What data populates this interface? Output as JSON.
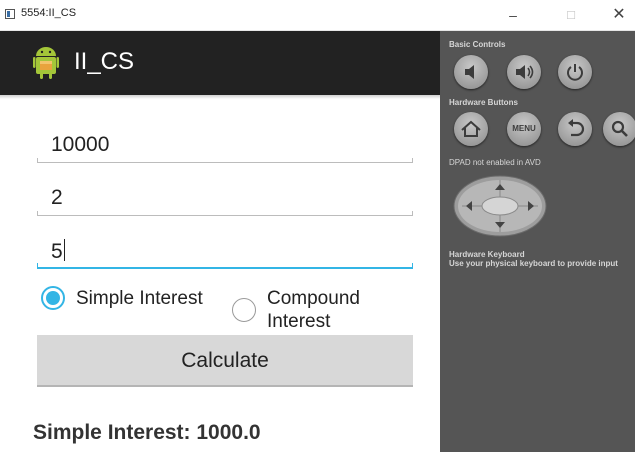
{
  "window": {
    "title": "5554:II_CS",
    "minimize": "–",
    "maximize": "□",
    "close": "✕"
  },
  "app": {
    "name": "II_CS",
    "fields": [
      {
        "value": "10000"
      },
      {
        "value": "2"
      },
      {
        "value": "5"
      }
    ],
    "radio_simple": {
      "label": "Simple Interest",
      "checked": true
    },
    "radio_compound": {
      "label": "Compound Interest",
      "label_line1": "Compound",
      "label_line2": "Interest",
      "checked": false
    },
    "calculate_label": "Calculate",
    "result": "Simple Interest: 1000.0"
  },
  "panel": {
    "basic_controls": "Basic Controls",
    "hardware_buttons": "Hardware Buttons",
    "menu_label": "MENU",
    "dpad_notice": "DPAD not enabled in AVD",
    "keyboard_title": "Hardware Keyboard",
    "keyboard_hint": "Use your physical keyboard to provide input"
  },
  "colors": {
    "accent": "#33b5e5",
    "actionbar": "#222222",
    "panel": "#555555",
    "android_green": "#a4c639"
  }
}
